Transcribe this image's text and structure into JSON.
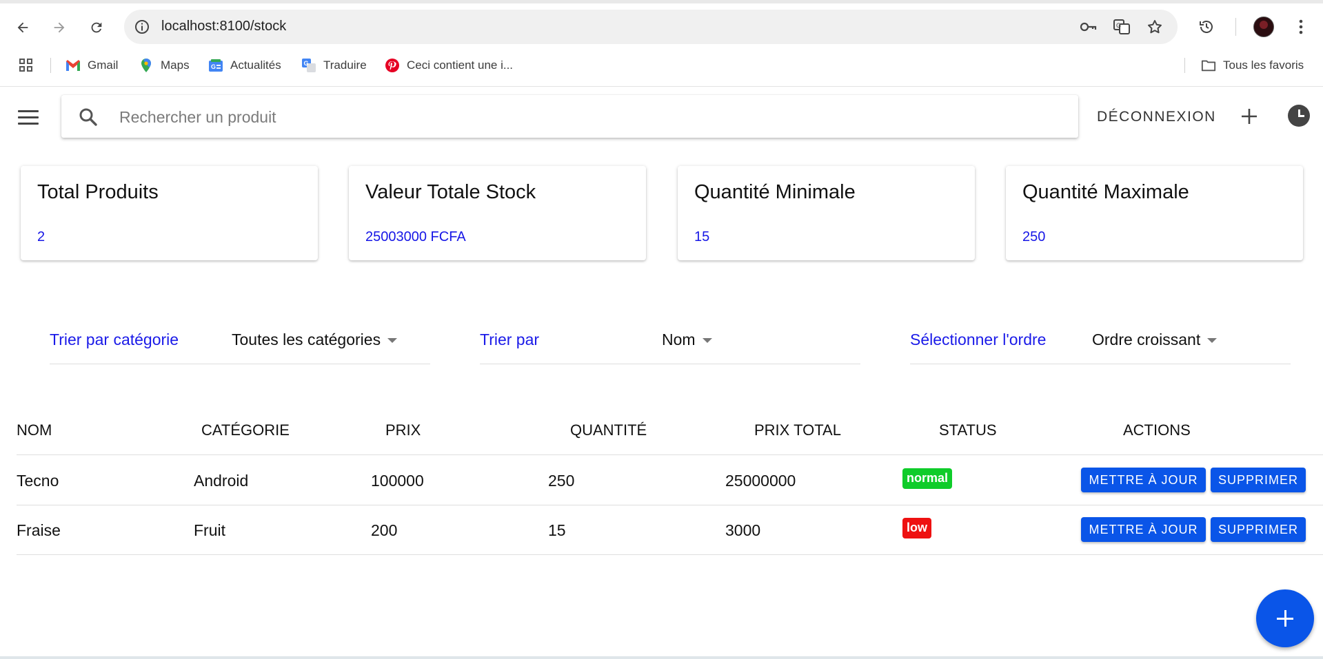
{
  "browser": {
    "url": "localhost:8100/stock",
    "bookmarks": [
      {
        "label": "Gmail",
        "icon": "gmail-icon"
      },
      {
        "label": "Maps",
        "icon": "maps-icon"
      },
      {
        "label": "Actualités",
        "icon": "news-icon"
      },
      {
        "label": "Traduire",
        "icon": "translate-icon"
      },
      {
        "label": "Ceci contient une i...",
        "icon": "pinterest-icon"
      }
    ],
    "all_bookmarks_label": "Tous les favoris"
  },
  "toolbar": {
    "search_placeholder": "Rechercher un produit",
    "logout_label": "DÉCONNEXION"
  },
  "stats": [
    {
      "title": "Total Produits",
      "value": "2"
    },
    {
      "title": "Valeur Totale Stock",
      "value": "25003000 FCFA"
    },
    {
      "title": "Quantité Minimale",
      "value": "15"
    },
    {
      "title": "Quantité Maximale",
      "value": "250"
    }
  ],
  "filters": {
    "category": {
      "label": "Trier par catégorie",
      "value": "Toutes les catégories"
    },
    "sort": {
      "label": "Trier par",
      "value": "Nom"
    },
    "order": {
      "label": "Sélectionner l'ordre",
      "value": "Ordre croissant"
    }
  },
  "table": {
    "headers": [
      "NOM",
      "CATÉGORIE",
      "PRIX",
      "QUANTITÉ",
      "PRIX TOTAL",
      "STATUS",
      "ACTIONS"
    ],
    "rows": [
      {
        "nom": "Tecno",
        "categorie": "Android",
        "prix": "100000",
        "quantite": "250",
        "prix_total": "25000000",
        "status": "normal",
        "status_color": "#0fcc2a"
      },
      {
        "nom": "Fraise",
        "categorie": "Fruit",
        "prix": "200",
        "quantite": "15",
        "prix_total": "3000",
        "status": "low",
        "status_color": "#ee1111"
      }
    ],
    "update_label": "METTRE À JOUR",
    "delete_label": "SUPPRIMER"
  },
  "colors": {
    "accent": "#0a55e8",
    "link_blue": "#1a1ae8"
  }
}
